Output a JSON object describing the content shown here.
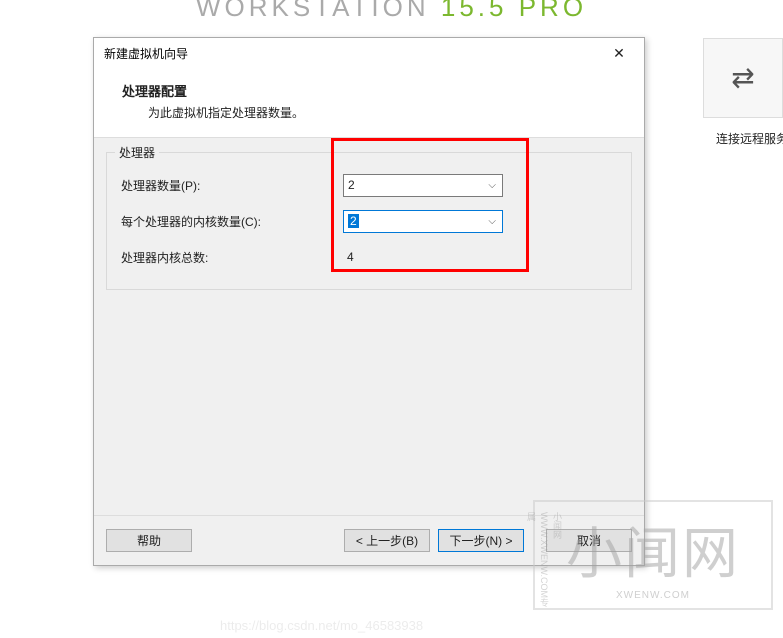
{
  "background": {
    "app_title_part1": "WORKSTATION",
    "app_title_part2": " 15.5 ",
    "app_title_part3": "PRO",
    "connect_remote_label": "连接远程服务"
  },
  "dialog": {
    "title": "新建虚拟机向导",
    "header_title": "处理器配置",
    "header_desc": "为此虚拟机指定处理器数量。",
    "fieldset_legend": "处理器",
    "rows": {
      "proc_count_label": "处理器数量(P):",
      "proc_count_value": "2",
      "cores_per_label": "每个处理器的内核数量(C):",
      "cores_per_value": "2",
      "total_cores_label": "处理器内核总数:",
      "total_cores_value": "4"
    },
    "buttons": {
      "help": "帮助",
      "back": "< 上一步(B)",
      "next": "下一步(N) >",
      "cancel": "取消"
    }
  },
  "watermarks": {
    "blog": "https://blog.csdn.net/mo_46583938",
    "wm_big": "小闻网",
    "wm_small": "XWENW.COM",
    "wm_side": "小闻网 WWW.XWENW.COM专属"
  }
}
